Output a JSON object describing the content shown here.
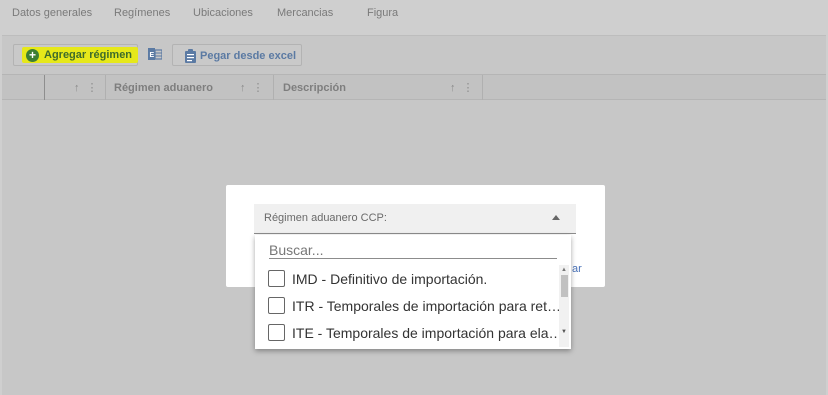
{
  "tabs": [
    {
      "label": "Datos generales"
    },
    {
      "label": "Regímenes"
    },
    {
      "label": "Ubicaciones"
    },
    {
      "label": "Mercancias"
    },
    {
      "label": "Figura"
    }
  ],
  "toolbar": {
    "add_label": "Agregar régimen",
    "add_icon": "plus-circle-icon",
    "excel_icon": "excel-icon",
    "paste_label": "Pegar desde excel",
    "paste_icon": "clipboard-icon",
    "highlight_color": "#e6e81a"
  },
  "grid": {
    "columns": [
      {
        "title": "",
        "sort": "↑ ⋮"
      },
      {
        "title": "Régimen aduanero",
        "sort": "↑ ⋮"
      },
      {
        "title": "Descripción",
        "sort": "↑ ⋮"
      }
    ]
  },
  "modal": {
    "select_label": "Régimen aduanero CCP:",
    "partial_link": "ar"
  },
  "dropdown": {
    "search_placeholder": "Buscar...",
    "options": [
      {
        "label": "IMD - Definitivo de importación."
      },
      {
        "label": "ITR - Temporales de importación para ret…"
      },
      {
        "label": "ITE - Temporales de importación para ela…"
      }
    ]
  }
}
